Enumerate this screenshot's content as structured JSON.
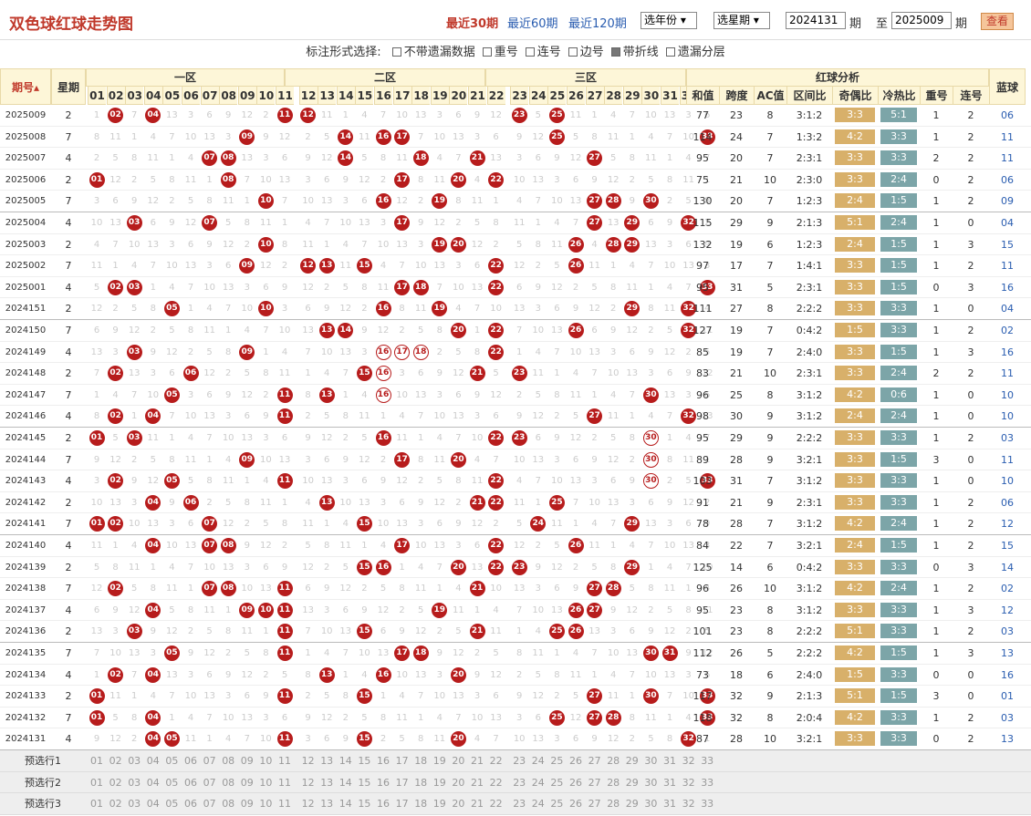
{
  "header": {
    "title": "双色球红球走势图",
    "periods": [
      "最近30期",
      "最近60期",
      "最近120期"
    ],
    "year_select": "选年份",
    "period_select": "选星期",
    "from_value": "2024131",
    "from_label": "期",
    "to_label": "至",
    "to_value": "2025009",
    "to_suffix": "期",
    "view_button": "查看"
  },
  "options": {
    "label": "标注形式选择:",
    "items": [
      {
        "label": "不带遗漏数据",
        "checked": false
      },
      {
        "label": "重号",
        "checked": false
      },
      {
        "label": "连号",
        "checked": false
      },
      {
        "label": "边号",
        "checked": false
      },
      {
        "label": "带折线",
        "checked": true
      },
      {
        "label": "遗漏分层",
        "checked": false
      }
    ]
  },
  "table": {
    "h_period": "期号",
    "h_week": "星期",
    "zones": [
      "一区",
      "二区",
      "三区"
    ],
    "h_analysis": "红球分析",
    "h_blue": "蓝球",
    "analysis_cols": [
      "和值",
      "跨度",
      "AC值",
      "区间比",
      "奇偶比",
      "冷热比",
      "重号",
      "连号"
    ],
    "numbers": [
      "01",
      "02",
      "03",
      "04",
      "05",
      "06",
      "07",
      "08",
      "09",
      "10",
      "11",
      "12",
      "13",
      "14",
      "15",
      "16",
      "17",
      "18",
      "19",
      "20",
      "21",
      "22",
      "23",
      "24",
      "25",
      "26",
      "27",
      "28",
      "29",
      "30",
      "31",
      "32",
      "33"
    ],
    "rows": [
      {
        "p": "2025009",
        "w": "2",
        "balls": [
          2,
          4,
          11,
          12,
          23,
          25
        ],
        "sum": "77",
        "span": "23",
        "ac": "8",
        "zone": "3:1:2",
        "oe": "3:3",
        "ch": "5:1",
        "rep": "1",
        "cons": "2",
        "blue": "06"
      },
      {
        "p": "2025008",
        "w": "7",
        "balls": [
          9,
          14,
          16,
          17,
          25,
          33
        ],
        "sum": "114",
        "span": "24",
        "ac": "7",
        "zone": "1:3:2",
        "oe": "4:2",
        "ch": "3:3",
        "rep": "1",
        "cons": "2",
        "blue": "11"
      },
      {
        "p": "2025007",
        "w": "4",
        "balls": [
          7,
          8,
          14,
          18,
          21,
          27
        ],
        "sum": "95",
        "span": "20",
        "ac": "7",
        "zone": "2:3:1",
        "oe": "3:3",
        "ch": "3:3",
        "rep": "2",
        "cons": "2",
        "blue": "11"
      },
      {
        "p": "2025006",
        "w": "2",
        "balls": [
          1,
          8,
          17,
          20,
          22
        ],
        "sum": "75",
        "span": "21",
        "ac": "10",
        "zone": "2:3:0",
        "oe": "3:3",
        "ch": "2:4",
        "rep": "0",
        "cons": "2",
        "blue": "06"
      },
      {
        "p": "2025005",
        "w": "7",
        "balls": [
          10,
          16,
          19,
          27,
          28,
          30
        ],
        "sum": "130",
        "span": "20",
        "ac": "7",
        "zone": "1:2:3",
        "oe": "2:4",
        "ch": "1:5",
        "rep": "1",
        "cons": "2",
        "blue": "09"
      },
      {
        "p": "2025004",
        "w": "4",
        "balls": [
          3,
          7,
          17,
          27,
          29,
          32
        ],
        "sum": "115",
        "span": "29",
        "ac": "9",
        "zone": "2:1:3",
        "oe": "5:1",
        "ch": "2:4",
        "rep": "1",
        "cons": "0",
        "blue": "04"
      },
      {
        "p": "2025003",
        "w": "2",
        "balls": [
          10,
          19,
          20,
          26,
          28,
          29
        ],
        "sum": "132",
        "span": "19",
        "ac": "6",
        "zone": "1:2:3",
        "oe": "2:4",
        "ch": "1:5",
        "rep": "1",
        "cons": "3",
        "blue": "15"
      },
      {
        "p": "2025002",
        "w": "7",
        "balls": [
          9,
          12,
          13,
          15,
          22,
          26
        ],
        "sum": "97",
        "span": "17",
        "ac": "7",
        "zone": "1:4:1",
        "oe": "3:3",
        "ch": "1:5",
        "rep": "1",
        "cons": "2",
        "blue": "11"
      },
      {
        "p": "2025001",
        "w": "4",
        "balls": [
          2,
          3,
          17,
          18,
          22,
          33
        ],
        "sum": "95",
        "span": "31",
        "ac": "5",
        "zone": "2:3:1",
        "oe": "3:3",
        "ch": "1:5",
        "rep": "0",
        "cons": "3",
        "blue": "16"
      },
      {
        "p": "2024151",
        "w": "2",
        "balls": [
          5,
          10,
          16,
          19,
          29,
          32
        ],
        "sum": "111",
        "span": "27",
        "ac": "8",
        "zone": "2:2:2",
        "oe": "3:3",
        "ch": "3:3",
        "rep": "1",
        "cons": "0",
        "blue": "04"
      },
      {
        "p": "2024150",
        "w": "7",
        "balls": [
          13,
          14,
          20,
          22,
          26,
          32
        ],
        "sum": "127",
        "span": "19",
        "ac": "7",
        "zone": "0:4:2",
        "oe": "1:5",
        "ch": "3:3",
        "rep": "1",
        "cons": "2",
        "blue": "02"
      },
      {
        "p": "2024149",
        "w": "4",
        "balls": [
          3,
          9,
          22
        ],
        "ring": [
          16,
          17,
          18
        ],
        "sum": "85",
        "span": "19",
        "ac": "7",
        "zone": "2:4:0",
        "oe": "3:3",
        "ch": "1:5",
        "rep": "1",
        "cons": "3",
        "blue": "16"
      },
      {
        "p": "2024148",
        "w": "2",
        "balls": [
          2,
          6,
          15,
          21,
          23
        ],
        "ring": [
          16
        ],
        "sum": "83",
        "span": "21",
        "ac": "10",
        "zone": "2:3:1",
        "oe": "3:3",
        "ch": "2:4",
        "rep": "2",
        "cons": "2",
        "blue": "11"
      },
      {
        "p": "2024147",
        "w": "7",
        "balls": [
          5,
          11,
          13,
          30
        ],
        "ring": [
          16
        ],
        "sum": "96",
        "span": "25",
        "ac": "8",
        "zone": "3:1:2",
        "oe": "4:2",
        "ch": "0:6",
        "rep": "1",
        "cons": "0",
        "blue": "10"
      },
      {
        "p": "2024146",
        "w": "4",
        "balls": [
          2,
          4,
          11,
          27,
          32
        ],
        "sum": "98",
        "span": "30",
        "ac": "9",
        "zone": "3:1:2",
        "oe": "2:4",
        "ch": "2:4",
        "rep": "1",
        "cons": "0",
        "blue": "10"
      },
      {
        "p": "2024145",
        "w": "2",
        "balls": [
          1,
          3,
          16,
          22,
          23
        ],
        "ring": [
          30
        ],
        "sum": "95",
        "span": "29",
        "ac": "9",
        "zone": "2:2:2",
        "oe": "3:3",
        "ch": "3:3",
        "rep": "1",
        "cons": "2",
        "blue": "03"
      },
      {
        "p": "2024144",
        "w": "7",
        "balls": [
          9,
          17,
          20
        ],
        "ring": [
          30
        ],
        "sum": "89",
        "span": "28",
        "ac": "9",
        "zone": "3:2:1",
        "oe": "3:3",
        "ch": "1:5",
        "rep": "3",
        "cons": "0",
        "blue": "11"
      },
      {
        "p": "2024143",
        "w": "4",
        "balls": [
          2,
          5,
          11,
          22,
          33
        ],
        "ring": [
          30
        ],
        "sum": "103",
        "span": "31",
        "ac": "7",
        "zone": "3:1:2",
        "oe": "3:3",
        "ch": "3:3",
        "rep": "1",
        "cons": "0",
        "blue": "10"
      },
      {
        "p": "2024142",
        "w": "2",
        "balls": [
          4,
          6,
          13,
          21,
          22,
          25
        ],
        "sum": "91",
        "span": "21",
        "ac": "9",
        "zone": "2:3:1",
        "oe": "3:3",
        "ch": "3:3",
        "rep": "1",
        "cons": "2",
        "blue": "06"
      },
      {
        "p": "2024141",
        "w": "7",
        "balls": [
          1,
          2,
          7,
          15,
          24,
          29
        ],
        "sum": "78",
        "span": "28",
        "ac": "7",
        "zone": "3:1:2",
        "oe": "4:2",
        "ch": "2:4",
        "rep": "1",
        "cons": "2",
        "blue": "12"
      },
      {
        "p": "2024140",
        "w": "4",
        "balls": [
          4,
          7,
          8,
          17,
          22,
          26
        ],
        "sum": "84",
        "span": "22",
        "ac": "7",
        "zone": "3:2:1",
        "oe": "2:4",
        "ch": "1:5",
        "rep": "1",
        "cons": "2",
        "blue": "15"
      },
      {
        "p": "2024139",
        "w": "2",
        "balls": [
          15,
          16,
          20,
          22,
          23,
          29
        ],
        "sum": "125",
        "span": "14",
        "ac": "6",
        "zone": "0:4:2",
        "oe": "3:3",
        "ch": "3:3",
        "rep": "0",
        "cons": "3",
        "blue": "14"
      },
      {
        "p": "2024138",
        "w": "7",
        "balls": [
          2,
          7,
          8,
          11,
          21,
          27,
          28
        ],
        "sum": "96",
        "span": "26",
        "ac": "10",
        "zone": "3:1:2",
        "oe": "4:2",
        "ch": "2:4",
        "rep": "1",
        "cons": "2",
        "blue": "02"
      },
      {
        "p": "2024137",
        "w": "4",
        "balls": [
          4,
          9,
          10,
          11,
          19,
          26,
          27
        ],
        "sum": "95",
        "span": "23",
        "ac": "8",
        "zone": "3:1:2",
        "oe": "3:3",
        "ch": "3:3",
        "rep": "1",
        "cons": "3",
        "blue": "12"
      },
      {
        "p": "2024136",
        "w": "2",
        "balls": [
          3,
          11,
          15,
          21,
          25,
          26
        ],
        "sum": "101",
        "span": "23",
        "ac": "8",
        "zone": "2:2:2",
        "oe": "5:1",
        "ch": "3:3",
        "rep": "1",
        "cons": "2",
        "blue": "03"
      },
      {
        "p": "2024135",
        "w": "7",
        "balls": [
          5,
          11,
          17,
          18,
          30,
          31
        ],
        "sum": "112",
        "span": "26",
        "ac": "5",
        "zone": "2:2:2",
        "oe": "4:2",
        "ch": "1:5",
        "rep": "1",
        "cons": "3",
        "blue": "13"
      },
      {
        "p": "2024134",
        "w": "4",
        "balls": [
          2,
          4,
          13,
          16,
          20
        ],
        "sum": "73",
        "span": "18",
        "ac": "6",
        "zone": "2:4:0",
        "oe": "1:5",
        "ch": "3:3",
        "rep": "0",
        "cons": "0",
        "blue": "16"
      },
      {
        "p": "2024133",
        "w": "2",
        "balls": [
          1,
          11,
          15,
          27,
          30,
          33
        ],
        "sum": "117",
        "span": "32",
        "ac": "9",
        "zone": "2:1:3",
        "oe": "5:1",
        "ch": "1:5",
        "rep": "3",
        "cons": "0",
        "blue": "01"
      },
      {
        "p": "2024132",
        "w": "7",
        "balls": [
          1,
          4,
          25,
          27,
          28,
          33
        ],
        "sum": "118",
        "span": "32",
        "ac": "8",
        "zone": "2:0:4",
        "oe": "4:2",
        "ch": "3:3",
        "rep": "1",
        "cons": "2",
        "blue": "03"
      },
      {
        "p": "2024131",
        "w": "4",
        "balls": [
          4,
          5,
          11,
          15,
          20,
          32
        ],
        "sum": "87",
        "span": "28",
        "ac": "10",
        "zone": "3:2:1",
        "oe": "3:3",
        "ch": "3:3",
        "rep": "0",
        "cons": "2",
        "blue": "13"
      }
    ],
    "pre_rows": [
      "预选行1",
      "预选行2",
      "预选行3"
    ]
  }
}
